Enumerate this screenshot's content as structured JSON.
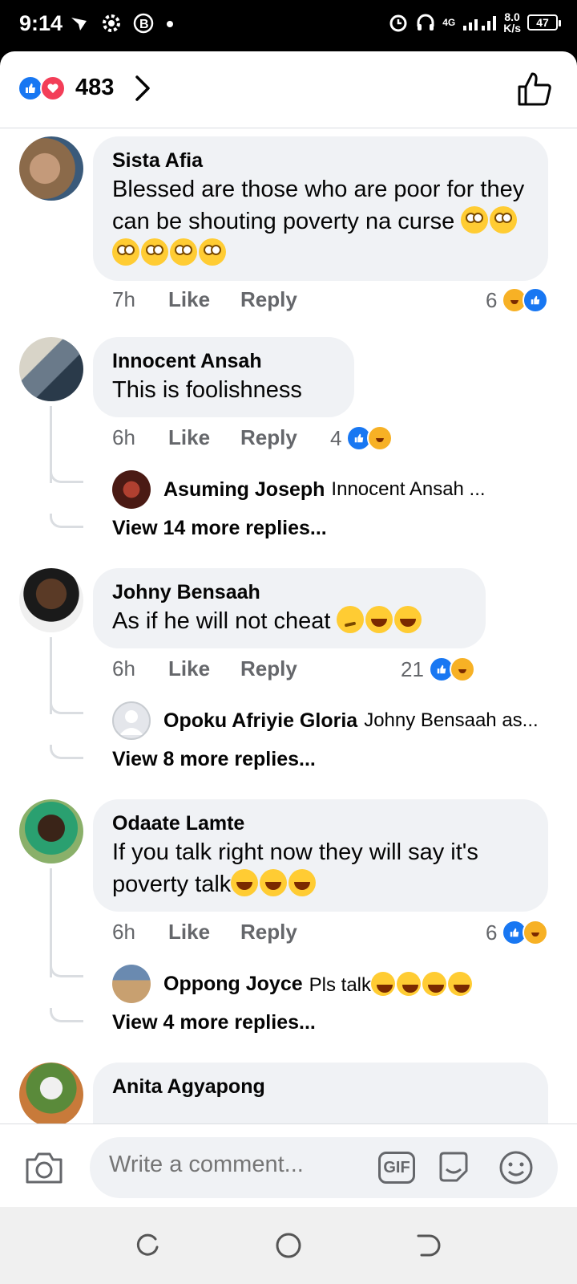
{
  "status_bar": {
    "time": "9:14",
    "network": "4G",
    "speed_value": "8.0",
    "speed_unit": "K/s",
    "battery": "47"
  },
  "header": {
    "reaction_count": "483",
    "reaction_icons": [
      "like-icon",
      "love-icon"
    ]
  },
  "comments": [
    {
      "author": "Sista Afia",
      "text": "Blessed are those who are poor for they  can be shouting poverty na curse",
      "emojis": [
        "face-with-rolling-eyes",
        "face-with-rolling-eyes",
        "face-with-rolling-eyes",
        "face-with-rolling-eyes",
        "face-with-rolling-eyes",
        "face-with-rolling-eyes"
      ],
      "time": "7h",
      "like_label": "Like",
      "reply_label": "Reply",
      "reaction_count": "6",
      "reaction_icons": [
        "haha-icon",
        "like-icon"
      ]
    },
    {
      "author": "Innocent Ansah",
      "text": "This is foolishness",
      "time": "6h",
      "like_label": "Like",
      "reply_label": "Reply",
      "reaction_count": "4",
      "reaction_icons": [
        "like-icon",
        "haha-icon"
      ],
      "reply_preview": {
        "author": "Asuming Joseph",
        "snippet": "Innocent Ansah ..."
      },
      "view_more": "View 14 more replies..."
    },
    {
      "author": "Johny Bensaah",
      "text": "As if he will not cheat",
      "emojis": [
        "smirking-face",
        "rolling-on-floor-laughing",
        "rolling-on-floor-laughing"
      ],
      "time": "6h",
      "like_label": "Like",
      "reply_label": "Reply",
      "reaction_count": "21",
      "reaction_icons": [
        "like-icon",
        "haha-icon"
      ],
      "reply_preview": {
        "author": "Opoku Afriyie Gloria",
        "snippet": "Johny Bensaah as..."
      },
      "view_more": "View 8 more replies..."
    },
    {
      "author": "Odaate Lamte",
      "text": "If you talk right now they will say it's poverty talk",
      "emojis": [
        "face-with-tears-of-joy",
        "face-with-tears-of-joy",
        "face-with-tears-of-joy"
      ],
      "time": "6h",
      "like_label": "Like",
      "reply_label": "Reply",
      "reaction_count": "6",
      "reaction_icons": [
        "like-icon",
        "haha-icon"
      ],
      "reply_preview": {
        "author": "Oppong Joyce",
        "snippet": "Pls talk"
      },
      "view_more": "View 4 more replies..."
    },
    {
      "author": "Anita Agyapong"
    }
  ],
  "composer": {
    "placeholder": "Write a comment...",
    "gif_label": "GIF"
  },
  "colors": {
    "like_blue": "#1877f2",
    "love_red": "#f33e58",
    "haha_yellow": "#f7b125",
    "bubble_bg": "#f0f2f5",
    "secondary_text": "#65676b"
  }
}
